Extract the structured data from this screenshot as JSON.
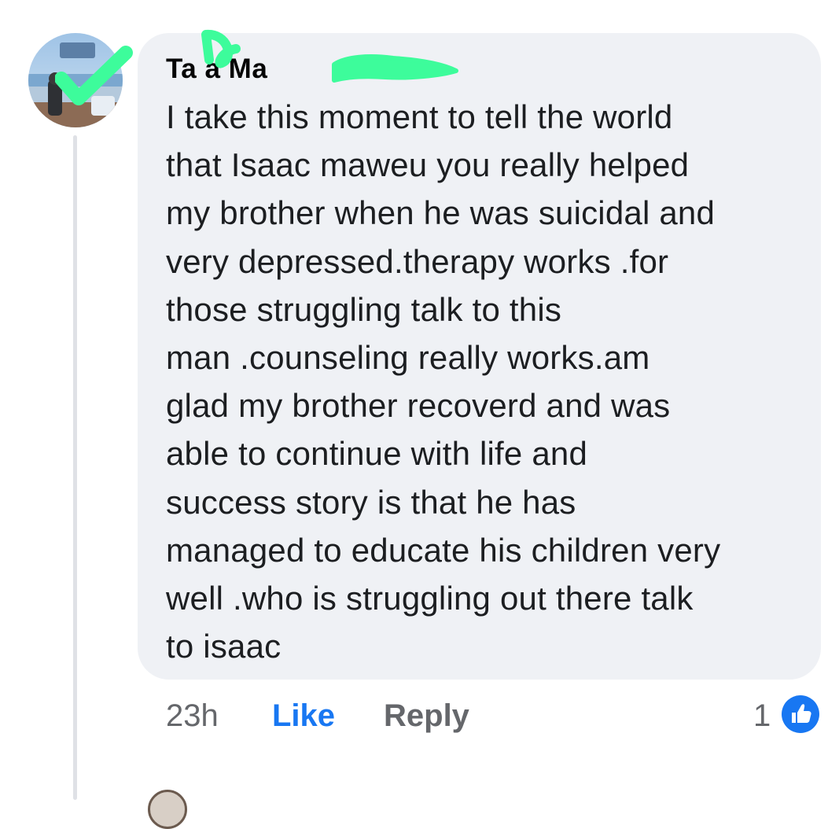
{
  "comment": {
    "author": "Ta a Ma",
    "text": "I take this moment to tell the world\nthat Isaac maweu you really helped\nmy brother when he was suicidal and\nvery depressed.therapy works .for\nthose struggling talk to this\nman .counseling really works.am\nglad my brother recoverd and was\nable to continue with life and\nsuccess story is that he has\nmanaged to educate his children very\nwell .who is struggling out there talk\nto isaac",
    "timestamp": "23h",
    "like_label": "Like",
    "reply_label": "Reply",
    "reaction_count": "1",
    "reaction_icon": "thumbs-up-icon"
  },
  "colors": {
    "bubble_bg": "#eff1f5",
    "like_blue": "#1877f2",
    "meta_gray": "#65676b",
    "redaction_green": "#3dfc9b"
  }
}
